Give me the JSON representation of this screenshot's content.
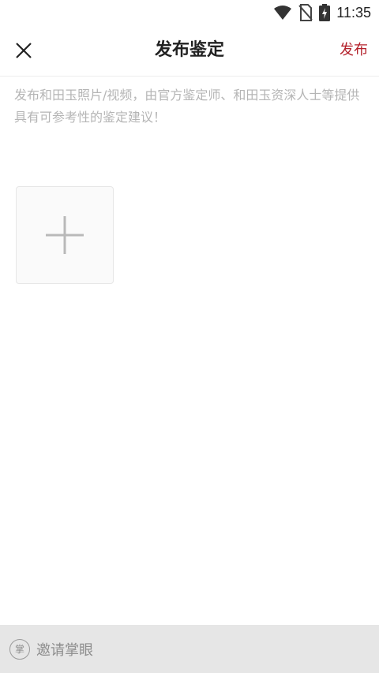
{
  "status_bar": {
    "time": "11:35",
    "icons": [
      "wifi-icon",
      "no-sim-icon",
      "battery-charging-icon"
    ]
  },
  "header": {
    "close_icon": "close-icon",
    "title": "发布鉴定",
    "publish_label": "发布",
    "publish_color": "#b3202a"
  },
  "main": {
    "hint_text": "发布和田玉照片/视频，由官方鉴定师、和田玉资深人士等提供具有可参考性的鉴定建议！",
    "add_media_icon": "plus-icon"
  },
  "bottom_bar": {
    "logo_char": "掌",
    "invite_label": "邀请掌眼"
  }
}
